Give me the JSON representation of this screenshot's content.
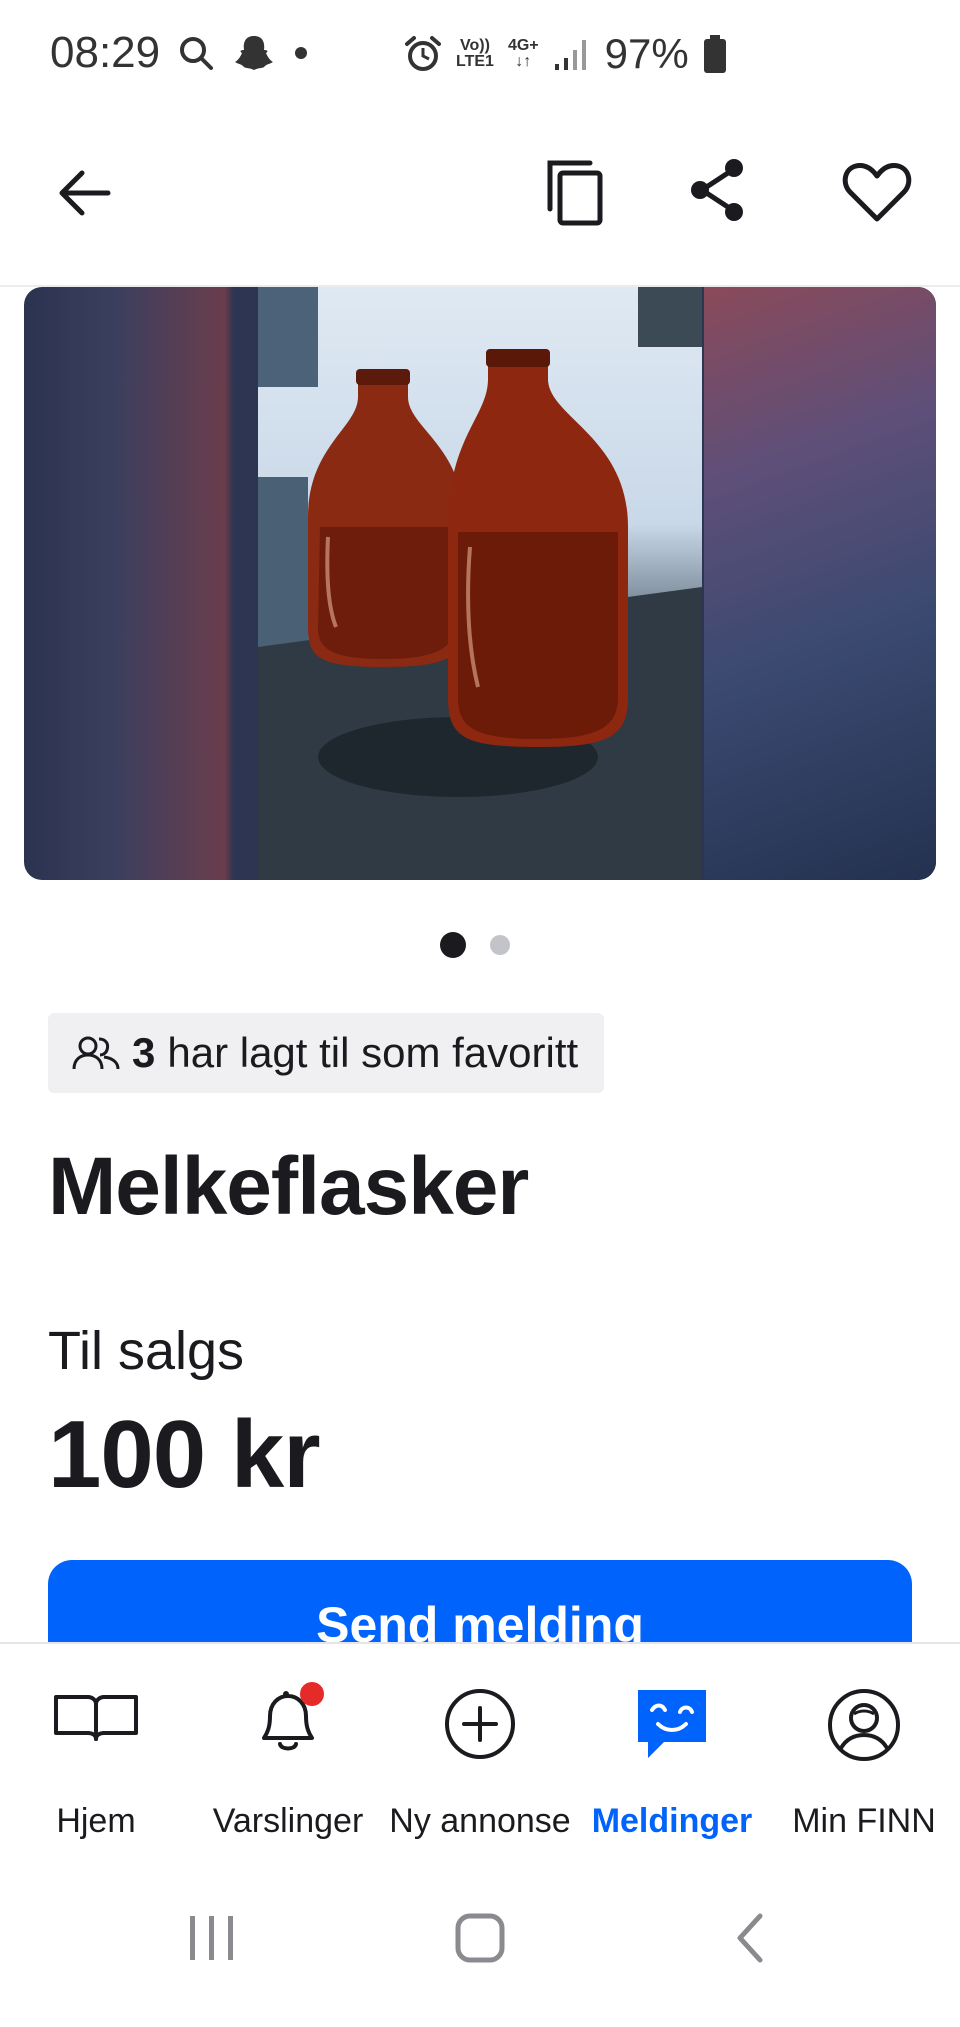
{
  "status_bar": {
    "time": "08:29",
    "volte_label_top": "Vo))",
    "volte_label_bottom": "LTE1",
    "network_label": "4G+",
    "battery": "97%"
  },
  "header": {
    "back_icon": "arrow-left-icon",
    "copy_icon": "copy-icon",
    "share_icon": "share-icon",
    "favorite_icon": "heart-icon"
  },
  "gallery": {
    "image_description_icon": "photo",
    "dots": {
      "total": 2,
      "active": 1
    }
  },
  "listing": {
    "favorite_count": "3",
    "favorite_text": "har lagt til som favoritt",
    "title": "Melkeflasker",
    "sale_type": "Til salgs",
    "price": "100 kr",
    "send_button": "Send melding"
  },
  "bottom_nav": {
    "items": [
      {
        "label": "Hjem",
        "icon": "book-icon"
      },
      {
        "label": "Varslinger",
        "icon": "bell-icon"
      },
      {
        "label": "Ny annonse",
        "icon": "plus-circle-icon"
      },
      {
        "label": "Meldinger",
        "icon": "chat-icon"
      },
      {
        "label": "Min FINN",
        "icon": "profile-icon"
      }
    ],
    "active_index": 3,
    "notification_dot_color": "#e52a2a"
  },
  "colors": {
    "accent": "#0063fb",
    "text": "#1b1b1f"
  }
}
